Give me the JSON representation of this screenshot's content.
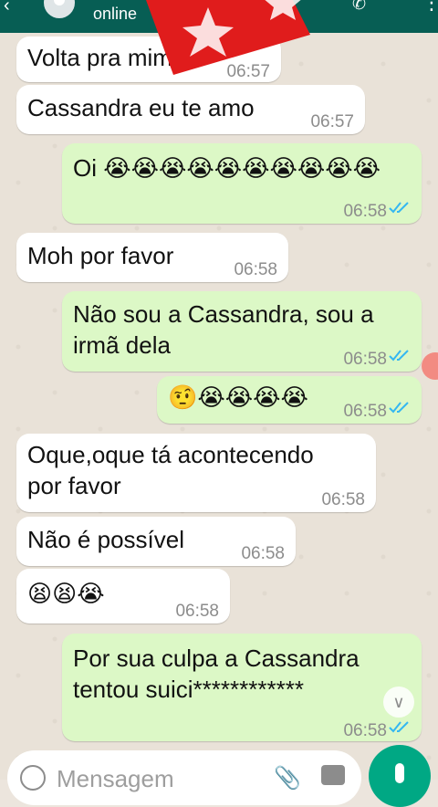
{
  "header": {
    "status": "online",
    "back_icon": "arrow-left-icon",
    "call_icon": "phone-icon",
    "menu_icon": "more-vert-icon"
  },
  "sticker": {
    "name": "red-star-sticker",
    "color": "#e01c1c"
  },
  "messages": [
    {
      "dir": "in",
      "text": "Volta pra mim",
      "time": "06:57"
    },
    {
      "dir": "in",
      "text": "Cassandra eu te amo",
      "time": "06:57"
    },
    {
      "dir": "out",
      "text": "Oi 😭😭😭😭😭😭😭😭😭😭",
      "time": "06:58",
      "read": true
    },
    {
      "dir": "in",
      "text": "Moh por favor",
      "time": "06:58"
    },
    {
      "dir": "out",
      "text": "Não sou a Cassandra, sou a\nirmã dela",
      "time": "06:58",
      "read": true
    },
    {
      "dir": "out",
      "text": "🤨😭😭😭😭",
      "time": "06:58",
      "read": true
    },
    {
      "dir": "in",
      "text": "Oque,oque tá acontecendo\npor favor",
      "time": "06:58"
    },
    {
      "dir": "in",
      "text": "Não é possível",
      "time": "06:58"
    },
    {
      "dir": "in",
      "text": "😫😫😭",
      "time": "06:58"
    },
    {
      "dir": "out",
      "text": "Por sua culpa a Cassandra\ntentou suici************",
      "time": "06:58",
      "read": true
    }
  ],
  "composer": {
    "placeholder": "Mensagem",
    "emoji_icon": "emoji-icon",
    "attach_icon": "paperclip-icon",
    "camera_icon": "camera-icon",
    "mic_icon": "mic-icon"
  },
  "colors": {
    "header": "#075e54",
    "outgoing": "#dcf8c6",
    "incoming": "#ffffff",
    "read_ticks": "#34b7f1",
    "mic_button": "#00a884"
  }
}
